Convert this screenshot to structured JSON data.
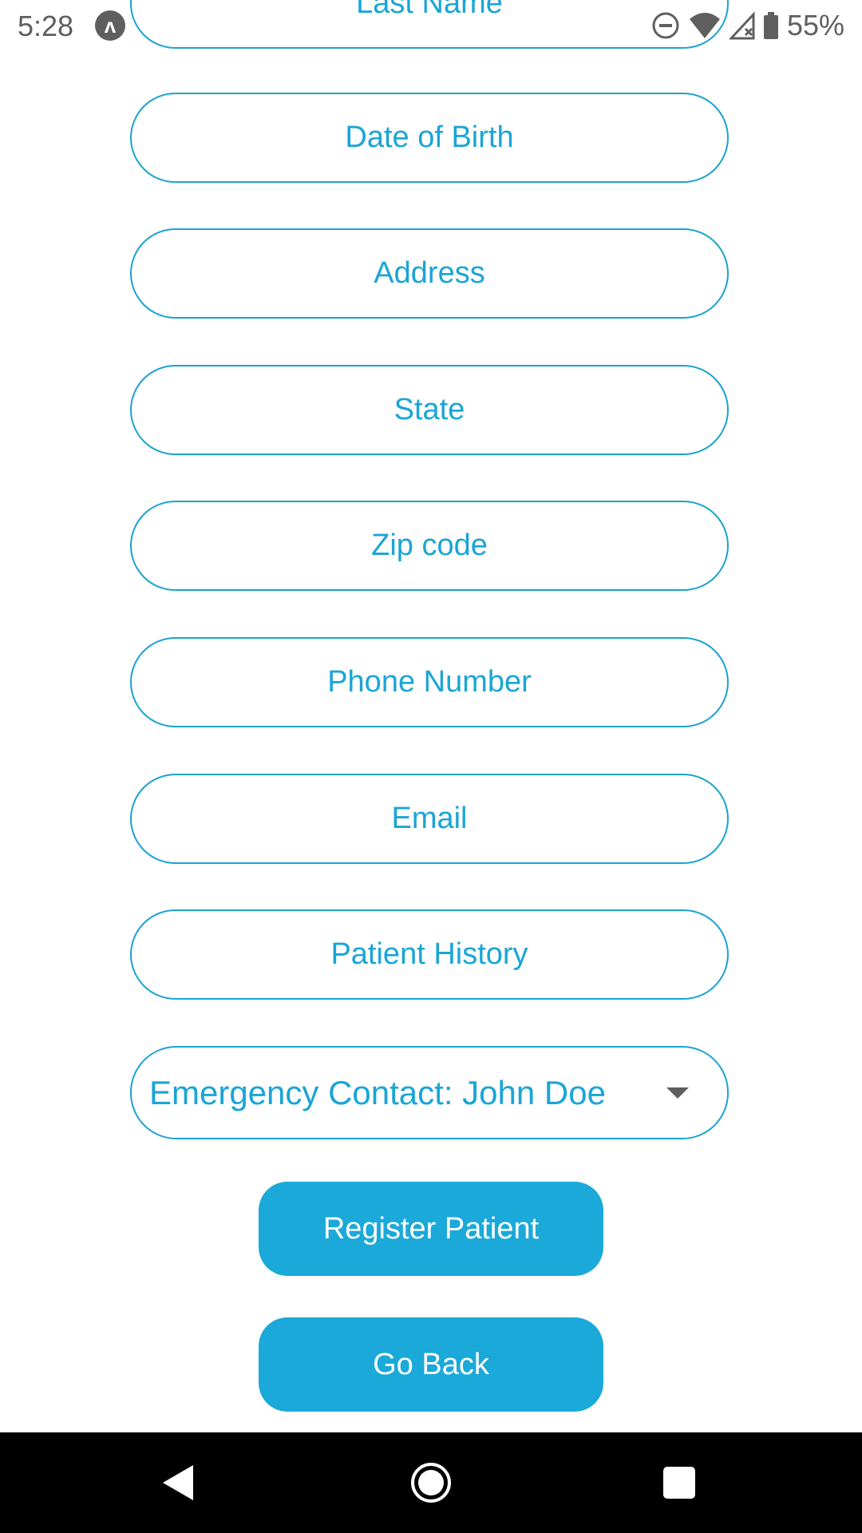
{
  "status_bar": {
    "time": "5:28",
    "app_icon_glyph": "ʌ",
    "battery_text": "55%",
    "icons": [
      "dnd-icon",
      "wifi-icon",
      "signal-icon",
      "battery-icon"
    ]
  },
  "form": {
    "last_name_placeholder": "Last Name",
    "dob_placeholder": "Date of Birth",
    "address_placeholder": "Address",
    "state_placeholder": "State",
    "zip_placeholder": "Zip code",
    "phone_placeholder": "Phone Number",
    "email_placeholder": "Email",
    "history_placeholder": "Patient History",
    "emergency_contact_selected": "Emergency Contact: John Doe"
  },
  "buttons": {
    "register_label": "Register Patient",
    "back_label": "Go Back"
  },
  "nav_bar": {
    "icons": [
      "back-icon",
      "home-icon",
      "recents-icon"
    ]
  },
  "colors": {
    "accent": "#1aa9d9",
    "field_border": "#1ba3d1",
    "status_gray": "#5f5f5f"
  }
}
